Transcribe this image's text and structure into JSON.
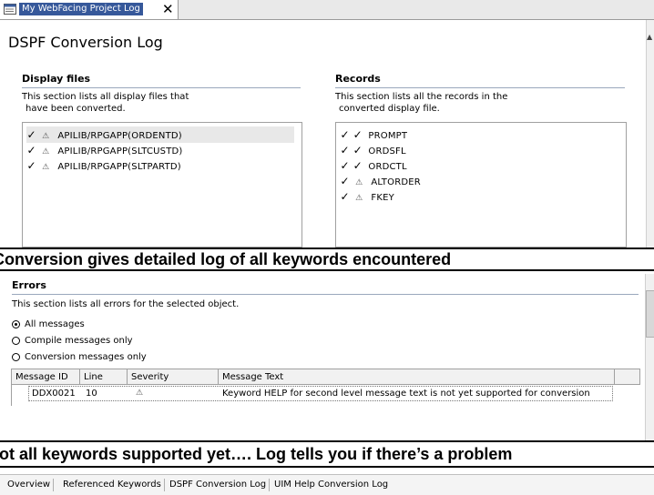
{
  "editor_tab": {
    "title": "My WebFacing Project Log",
    "close_glyph": "✕"
  },
  "page_title": "DSPF Conversion Log",
  "display_files": {
    "title": "Display files",
    "description_line1": "This section lists all display files that",
    "description_line2": "have been converted.",
    "items": [
      {
        "status": "✓",
        "warning": "⚠",
        "name": "APILIB/RPGAPP(ORDENTD)",
        "selected": true
      },
      {
        "status": "✓",
        "warning": "⚠",
        "name": "APILIB/RPGAPP(SLTCUSTD)",
        "selected": false
      },
      {
        "status": "✓",
        "warning": "⚠",
        "name": "APILIB/RPGAPP(SLTPARTD)",
        "selected": false
      }
    ]
  },
  "records": {
    "title": "Records",
    "description_line1": "This section lists all the records in the",
    "description_line2": "converted display file.",
    "items": [
      {
        "status": "✓",
        "status2": "✓",
        "name": "PROMPT"
      },
      {
        "status": "✓",
        "status2": "✓",
        "name": "ORDSFL"
      },
      {
        "status": "✓",
        "status2": "✓",
        "name": "ORDCTL"
      },
      {
        "status": "✓",
        "status2": "⚠",
        "name": "ALTORDER"
      },
      {
        "status": "✓",
        "status2": "⚠",
        "name": "FKEY"
      }
    ]
  },
  "caption_top": "Conversion gives detailed log of all keywords encountered",
  "errors": {
    "title": "Errors",
    "description": "This section lists all errors for the selected object.",
    "filters": [
      {
        "label": "All messages",
        "checked": true
      },
      {
        "label": "Compile messages only",
        "checked": false
      },
      {
        "label": "Conversion messages only",
        "checked": false
      }
    ],
    "columns": [
      "Message ID",
      "Line",
      "Severity",
      "Message Text"
    ],
    "rows": [
      {
        "message_id": "DDX0021",
        "line": "10",
        "severity": "⚠",
        "message_text": "Keyword HELP for second level message text is not yet supported for conversion"
      }
    ]
  },
  "caption_bottom": "Not all keywords supported yet…. Log tells you if there’s a problem",
  "bottom_tabs": [
    "Overview",
    "Referenced Keywords",
    "DSPF Conversion Log",
    "UIM Help Conversion Log"
  ],
  "colors": {
    "tab_title_bg": "#36589a",
    "section_rule": "#9aa8bc"
  }
}
